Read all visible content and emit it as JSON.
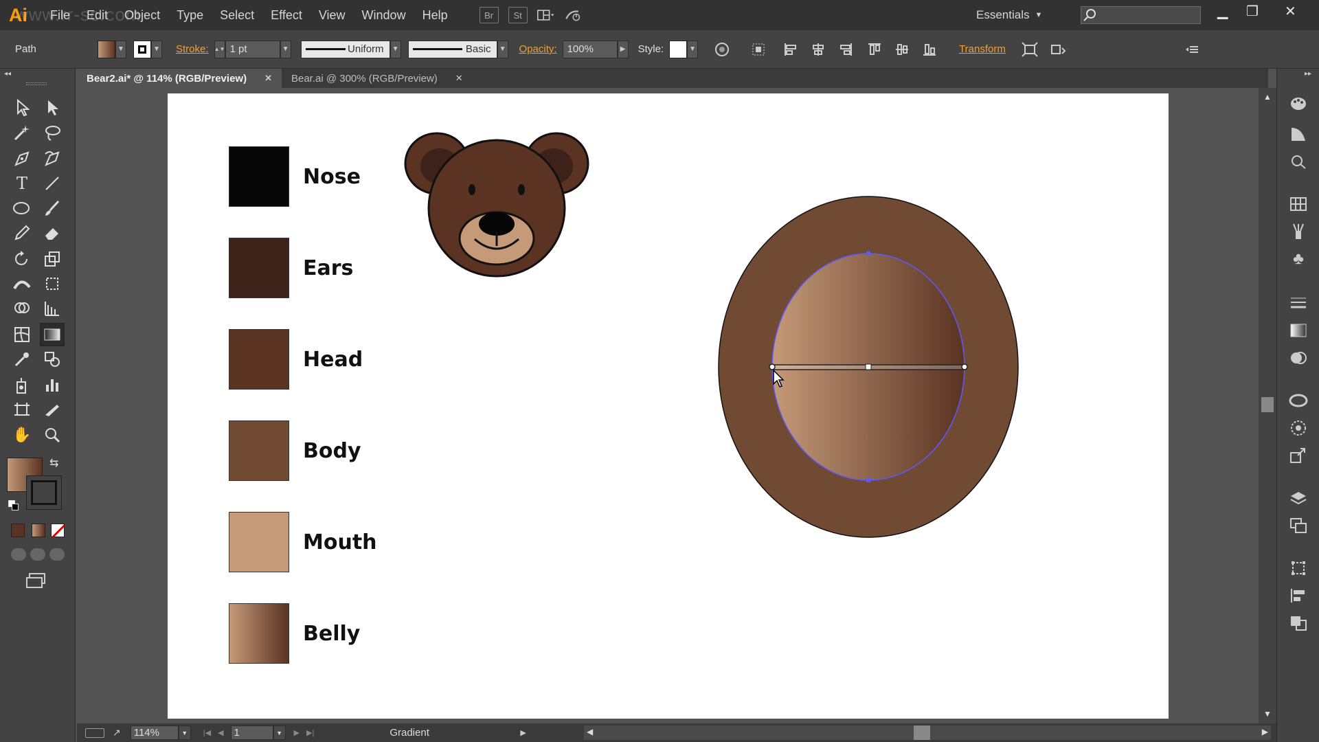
{
  "app": {
    "logo": "Ai",
    "watermark": "www.rr-sc.com"
  },
  "menu": [
    "File",
    "Edit",
    "Object",
    "Type",
    "Select",
    "Effect",
    "View",
    "Window",
    "Help"
  ],
  "menu_buttons": {
    "bridge": "Br",
    "stock": "St"
  },
  "workspace": {
    "label": "Essentials"
  },
  "control_bar": {
    "selection_type": "Path",
    "stroke_label": "Stroke:",
    "stroke_weight": "1 pt",
    "profile": "Uniform",
    "brush": "Basic",
    "opacity_label": "Opacity:",
    "opacity_value": "100%",
    "style_label": "Style:",
    "transform_label": "Transform"
  },
  "tabs": [
    {
      "label": "Bear2.ai* @ 114% (RGB/Preview)",
      "active": true
    },
    {
      "label": "Bear.ai @ 300% (RGB/Preview)",
      "active": false
    }
  ],
  "legend": [
    {
      "label": "Nose",
      "color": "#060606"
    },
    {
      "label": "Ears",
      "color": "#3c2219"
    },
    {
      "label": "Head",
      "color": "#5a3322"
    },
    {
      "label": "Body",
      "color": "#704a33"
    },
    {
      "label": "Mouth",
      "color": "#c49a78"
    },
    {
      "label": "Belly",
      "gradient": [
        "#c49a78",
        "#5a3322"
      ]
    }
  ],
  "status": {
    "zoom": "114%",
    "artboard": "1",
    "tool": "Gradient"
  },
  "colors": {
    "accent": "#f0a030",
    "ui_dark": "#323232",
    "ui_mid": "#434343",
    "canvas": "#535353"
  }
}
